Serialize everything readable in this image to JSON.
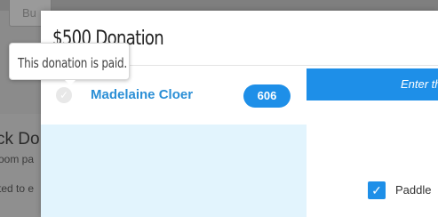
{
  "background": {
    "button_label": "Bu",
    "heading": "ck Do",
    "line1": "oom pa",
    "line2": "ted to e"
  },
  "modal": {
    "title": "$500 Donation",
    "donor": {
      "name": "Madelaine Cloer",
      "paddle_number": "606",
      "status_icon": "paid-check-icon"
    },
    "enter_bar_text": "Enter th",
    "checkbox": {
      "checked": true,
      "label": "Paddle"
    }
  },
  "tooltip": {
    "text": "This donation is paid."
  },
  "colors": {
    "accent": "#1e8fe8",
    "donor_name": "#2b8fd6",
    "list_bg": "#e2f4fd"
  }
}
